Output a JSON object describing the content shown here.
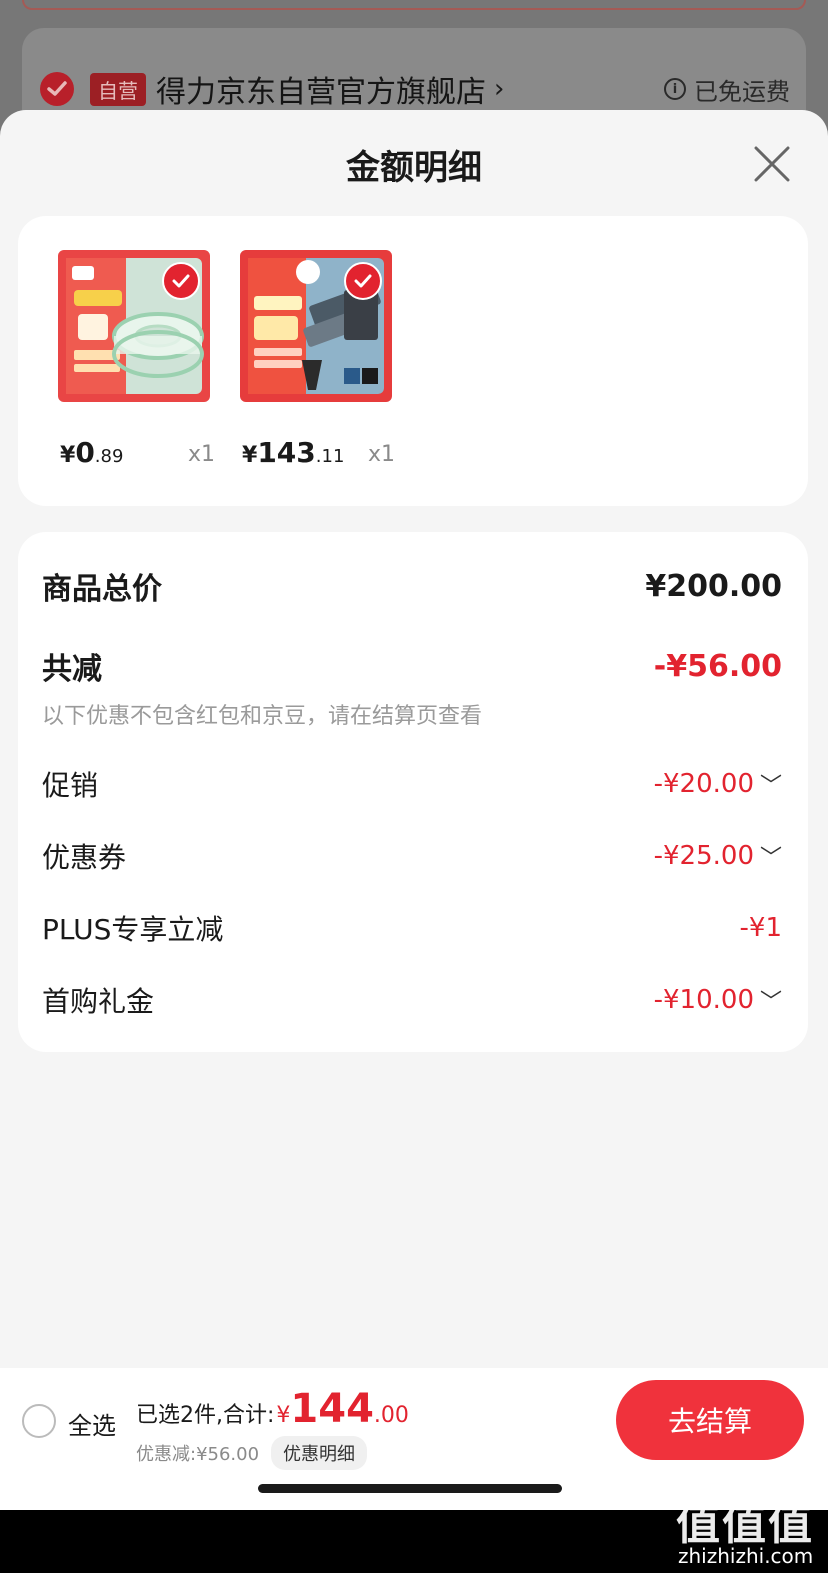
{
  "store": {
    "badge": "自营",
    "name": "得力京东自营官方旗舰店",
    "chevron": "›",
    "shipping": "已免运费"
  },
  "sheet": {
    "title": "金额明细"
  },
  "products": [
    {
      "currency": "¥",
      "price_int": "0",
      "price_dec": ".89",
      "qty": "x1"
    },
    {
      "currency": "¥",
      "price_int": "143",
      "price_dec": ".11",
      "qty": "x1"
    }
  ],
  "details": {
    "total_label": "商品总价",
    "total_value": "¥200.00",
    "reduce_label": "共减",
    "reduce_value": "-¥56.00",
    "note": "以下优惠不包含红包和京豆，请在结算页查看",
    "items": [
      {
        "label": "促销",
        "value": "-¥20.00",
        "expand": true
      },
      {
        "label": "优惠券",
        "value": "-¥25.00",
        "expand": true
      },
      {
        "label": "PLUS专享立减",
        "value": "-¥1",
        "expand": false
      },
      {
        "label": "首购礼金",
        "value": "-¥10.00",
        "expand": true
      }
    ]
  },
  "bottom": {
    "select_all": "全选",
    "selected_text": "已选2件,合计:",
    "total_yen": "¥",
    "total_int": "144",
    "total_dec": ".00",
    "discount_text": "优惠减:¥56.00",
    "detail_button": "优惠明细",
    "checkout": "去结算"
  },
  "watermark": {
    "chars": "值值值",
    "url": "zhizhizhi.com"
  },
  "colors": {
    "accent_red": "#e2232f",
    "checkout_red": "#f0323c"
  },
  "icons": {
    "check": "check-icon",
    "close": "close-icon",
    "info": "info-icon",
    "expand": "chevron-down-icon"
  }
}
